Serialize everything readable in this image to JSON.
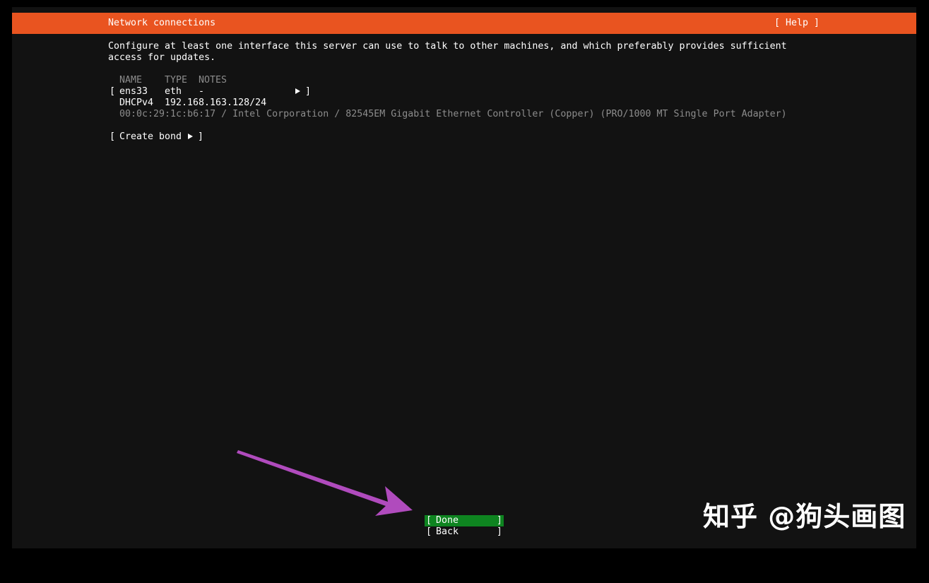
{
  "header": {
    "title": "Network connections",
    "help_label": "[ Help ]"
  },
  "description": {
    "line1": "Configure at least one interface this server can use to talk to other machines, and which preferably provides sufficient",
    "line2": "access for updates."
  },
  "table": {
    "columns": [
      "NAME",
      "TYPE",
      "NOTES"
    ],
    "interfaces": [
      {
        "name": "ens33",
        "type": "eth",
        "notes": "-",
        "address_mode": "DHCPv4",
        "address": "192.168.163.128/24",
        "details": "00:0c:29:1c:b6:17 / Intel Corporation / 82545EM Gigabit Ethernet Controller (Copper) (PRO/1000 MT Single Port Adapter)"
      }
    ]
  },
  "create_bond": {
    "label": "Create bond"
  },
  "buttons": {
    "done": "Done",
    "back": "Back"
  },
  "watermark": "知乎 @狗头画图",
  "colors": {
    "header_bg": "#e95420",
    "screen_bg": "#121212",
    "done_bg": "#0e8420",
    "dim_text": "#8c8c8c",
    "annotation_arrow": "#b04bbd"
  }
}
